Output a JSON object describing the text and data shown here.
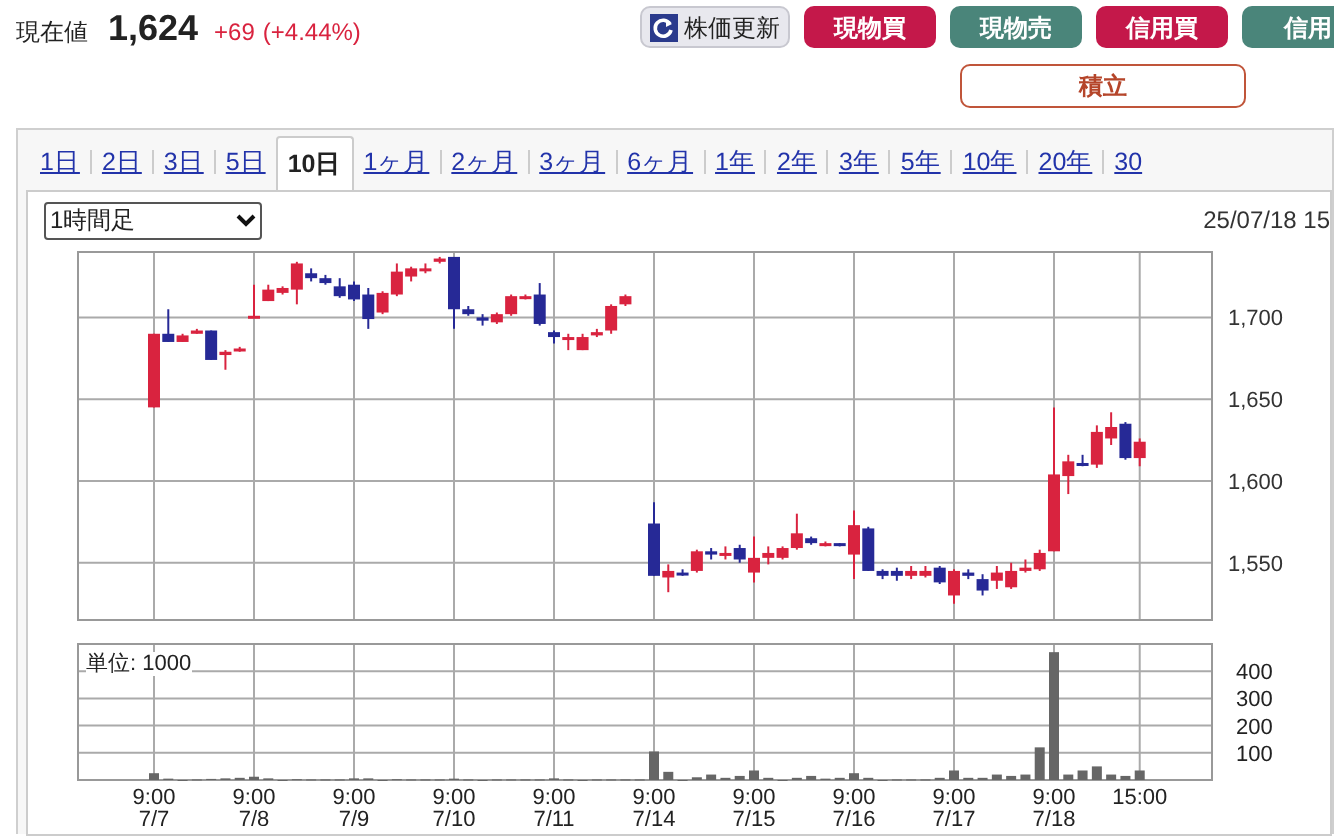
{
  "quote": {
    "label": "現在値",
    "price": "1,624",
    "change": "+69",
    "change_pct": "(+4.44%)"
  },
  "buttons": [
    {
      "label": "株価更新",
      "kind": "refresh"
    },
    {
      "label": "現物買",
      "kind": "buy"
    },
    {
      "label": "現物売",
      "kind": "sell"
    },
    {
      "label": "信用買",
      "kind": "buy"
    },
    {
      "label": "信用",
      "kind": "sell"
    }
  ],
  "accumulate_button": {
    "label": "積立"
  },
  "tabs": [
    {
      "label": "1日",
      "selected": false
    },
    {
      "label": "2日",
      "selected": false
    },
    {
      "label": "3日",
      "selected": false
    },
    {
      "label": "5日",
      "selected": false
    },
    {
      "label": "10日",
      "selected": true
    },
    {
      "label": "1ヶ月",
      "selected": false
    },
    {
      "label": "2ヶ月",
      "selected": false
    },
    {
      "label": "3ヶ月",
      "selected": false
    },
    {
      "label": "6ヶ月",
      "selected": false
    },
    {
      "label": "1年",
      "selected": false
    },
    {
      "label": "2年",
      "selected": false
    },
    {
      "label": "3年",
      "selected": false
    },
    {
      "label": "5年",
      "selected": false
    },
    {
      "label": "10年",
      "selected": false
    },
    {
      "label": "20年",
      "selected": false
    },
    {
      "label": "30",
      "selected": false
    }
  ],
  "interval_select": {
    "value": "1時間足"
  },
  "timestamp": "25/07/18 15",
  "price_chart": {
    "chart_data": {
      "type": "candlestick",
      "grid": true,
      "ylim": [
        1515,
        1740
      ],
      "yticks": [
        {
          "value": 1700,
          "label": "1,700"
        },
        {
          "value": 1650,
          "label": "1,650"
        },
        {
          "value": 1600,
          "label": "1,600"
        },
        {
          "value": 1550,
          "label": "1,550"
        }
      ],
      "categories": [
        null,
        null,
        null,
        null,
        null,
        null,
        null,
        null,
        null,
        null,
        null,
        null,
        null,
        null,
        null,
        null,
        null,
        null,
        null,
        null,
        null,
        null,
        null,
        null,
        null,
        null,
        null,
        null,
        null,
        null,
        null,
        null,
        null,
        null,
        null,
        null,
        null,
        null,
        null,
        null,
        null,
        null,
        null,
        null,
        null,
        null,
        null,
        null,
        null,
        null,
        null,
        null,
        null,
        null,
        null,
        null,
        null,
        null,
        null,
        null,
        null,
        null,
        null,
        null,
        null,
        null,
        null,
        null,
        null,
        null
      ],
      "ohlc": [
        [
          1645,
          1690,
          1645,
          1690
        ],
        [
          1690,
          1705,
          1685,
          1685
        ],
        [
          1685,
          1690,
          1685,
          1689
        ],
        [
          1690,
          1693,
          1690,
          1692
        ],
        [
          1692,
          1692,
          1674,
          1674
        ],
        [
          1677,
          1680,
          1668,
          1679
        ],
        [
          1680,
          1682,
          1679,
          1681
        ],
        [
          1700,
          1720,
          1700,
          1701
        ],
        [
          1710,
          1720,
          1710,
          1717
        ],
        [
          1715,
          1719,
          1714,
          1718
        ],
        [
          1717,
          1734,
          1708,
          1733
        ],
        [
          1727,
          1730,
          1722,
          1724
        ],
        [
          1724,
          1726,
          1720,
          1721
        ],
        [
          1719,
          1724,
          1712,
          1713
        ],
        [
          1720,
          1722,
          1710,
          1711
        ],
        [
          1714,
          1718,
          1693,
          1699
        ],
        [
          1703,
          1716,
          1702,
          1715
        ],
        [
          1714,
          1733,
          1713,
          1728
        ],
        [
          1725,
          1731,
          1722,
          1730
        ],
        [
          1729,
          1733,
          1727,
          1730
        ],
        [
          1734,
          1737,
          1733,
          1736
        ],
        [
          1737,
          1737,
          1693,
          1705
        ],
        [
          1705,
          1707,
          1701,
          1702
        ],
        [
          1700,
          1702,
          1695,
          1698
        ],
        [
          1697,
          1703,
          1696,
          1702
        ],
        [
          1702,
          1714,
          1701,
          1713
        ],
        [
          1712,
          1714,
          1711,
          1713
        ],
        [
          1714,
          1721,
          1695,
          1696
        ],
        [
          1691,
          1692,
          1684,
          1688
        ],
        [
          1687,
          1690,
          1680,
          1688
        ],
        [
          1680,
          1690,
          1680,
          1688
        ],
        [
          1689,
          1693,
          1688,
          1691
        ],
        [
          1692,
          1708,
          1690,
          1707
        ],
        [
          1708,
          1714,
          1707,
          1713
        ],
        null,
        [
          1574,
          1587,
          1542,
          1542
        ],
        [
          1541,
          1549,
          1532,
          1545
        ],
        [
          1544,
          1546,
          1542,
          1543
        ],
        [
          1545,
          1558,
          1544,
          1557
        ],
        [
          1557,
          1559,
          1552,
          1555
        ],
        [
          1555,
          1560,
          1552,
          1556
        ],
        [
          1559,
          1561,
          1550,
          1552
        ],
        [
          1544,
          1566,
          1538,
          1553
        ],
        [
          1553,
          1560,
          1549,
          1556
        ],
        [
          1553,
          1560,
          1552,
          1559
        ],
        [
          1559,
          1580,
          1558,
          1568
        ],
        [
          1565,
          1566,
          1561,
          1562
        ],
        [
          1561,
          1563,
          1560,
          1562
        ],
        [
          1562,
          1562,
          1560,
          1561
        ],
        [
          1555,
          1582,
          1540,
          1573
        ],
        [
          1571,
          1572,
          1545,
          1545
        ],
        [
          1545,
          1546,
          1540,
          1542
        ],
        [
          1545,
          1547,
          1539,
          1542
        ],
        [
          1542,
          1548,
          1540,
          1545
        ],
        [
          1542,
          1548,
          1541,
          1545
        ],
        [
          1547,
          1548,
          1537,
          1538
        ],
        [
          1530,
          1546,
          1525,
          1545
        ],
        [
          1544,
          1546,
          1540,
          1542
        ],
        [
          1540,
          1543,
          1530,
          1533
        ],
        [
          1539,
          1548,
          1534,
          1544
        ],
        [
          1535,
          1550,
          1534,
          1545
        ],
        [
          1545,
          1552,
          1544,
          1547
        ],
        [
          1546,
          1558,
          1545,
          1556
        ],
        [
          1557,
          1645,
          1557,
          1604
        ],
        [
          1603,
          1616,
          1592,
          1612
        ],
        [
          1611,
          1616,
          1609,
          1610
        ],
        [
          1610,
          1634,
          1608,
          1630
        ],
        [
          1626,
          1642,
          1622,
          1633
        ],
        [
          1635,
          1636,
          1613,
          1614
        ],
        [
          1614,
          1626,
          1609,
          1624
        ]
      ]
    }
  },
  "volume": {
    "unit_label": "単位: 1000",
    "chart_data": {
      "type": "bar",
      "grid": true,
      "ylim": [
        0,
        500
      ],
      "categories": [
        "9:00\n7/7",
        null,
        null,
        null,
        null,
        null,
        null,
        "9:00\n7/8",
        null,
        null,
        null,
        null,
        null,
        null,
        "9:00\n7/9",
        null,
        null,
        null,
        null,
        null,
        null,
        "9:00\n7/10",
        null,
        null,
        null,
        null,
        null,
        null,
        "9:00\n7/11",
        null,
        null,
        null,
        null,
        null,
        null,
        "9:00\n7/14",
        null,
        null,
        null,
        null,
        null,
        null,
        "9:00\n7/15",
        null,
        null,
        null,
        null,
        null,
        null,
        "9:00\n7/16",
        null,
        null,
        null,
        null,
        null,
        null,
        "9:00\n7/17",
        null,
        null,
        null,
        null,
        null,
        null,
        "9:00\n7/18",
        null,
        null,
        null,
        null,
        null,
        "15:00"
      ],
      "values": [
        25,
        5,
        0,
        2,
        4,
        6,
        8,
        12,
        6,
        0,
        3,
        2,
        2,
        2,
        6,
        6,
        0,
        3,
        2,
        2,
        2,
        5,
        2,
        0,
        2,
        2,
        2,
        2,
        6,
        2,
        0,
        2,
        2,
        2,
        2,
        105,
        30,
        0,
        10,
        20,
        8,
        15,
        35,
        8,
        0,
        8,
        15,
        5,
        8,
        25,
        8,
        0,
        2,
        2,
        2,
        8,
        35,
        8,
        8,
        20,
        15,
        20,
        120,
        470,
        20,
        35,
        50,
        20,
        15,
        35
      ],
      "yticks": [
        100,
        200,
        300,
        400
      ]
    }
  }
}
